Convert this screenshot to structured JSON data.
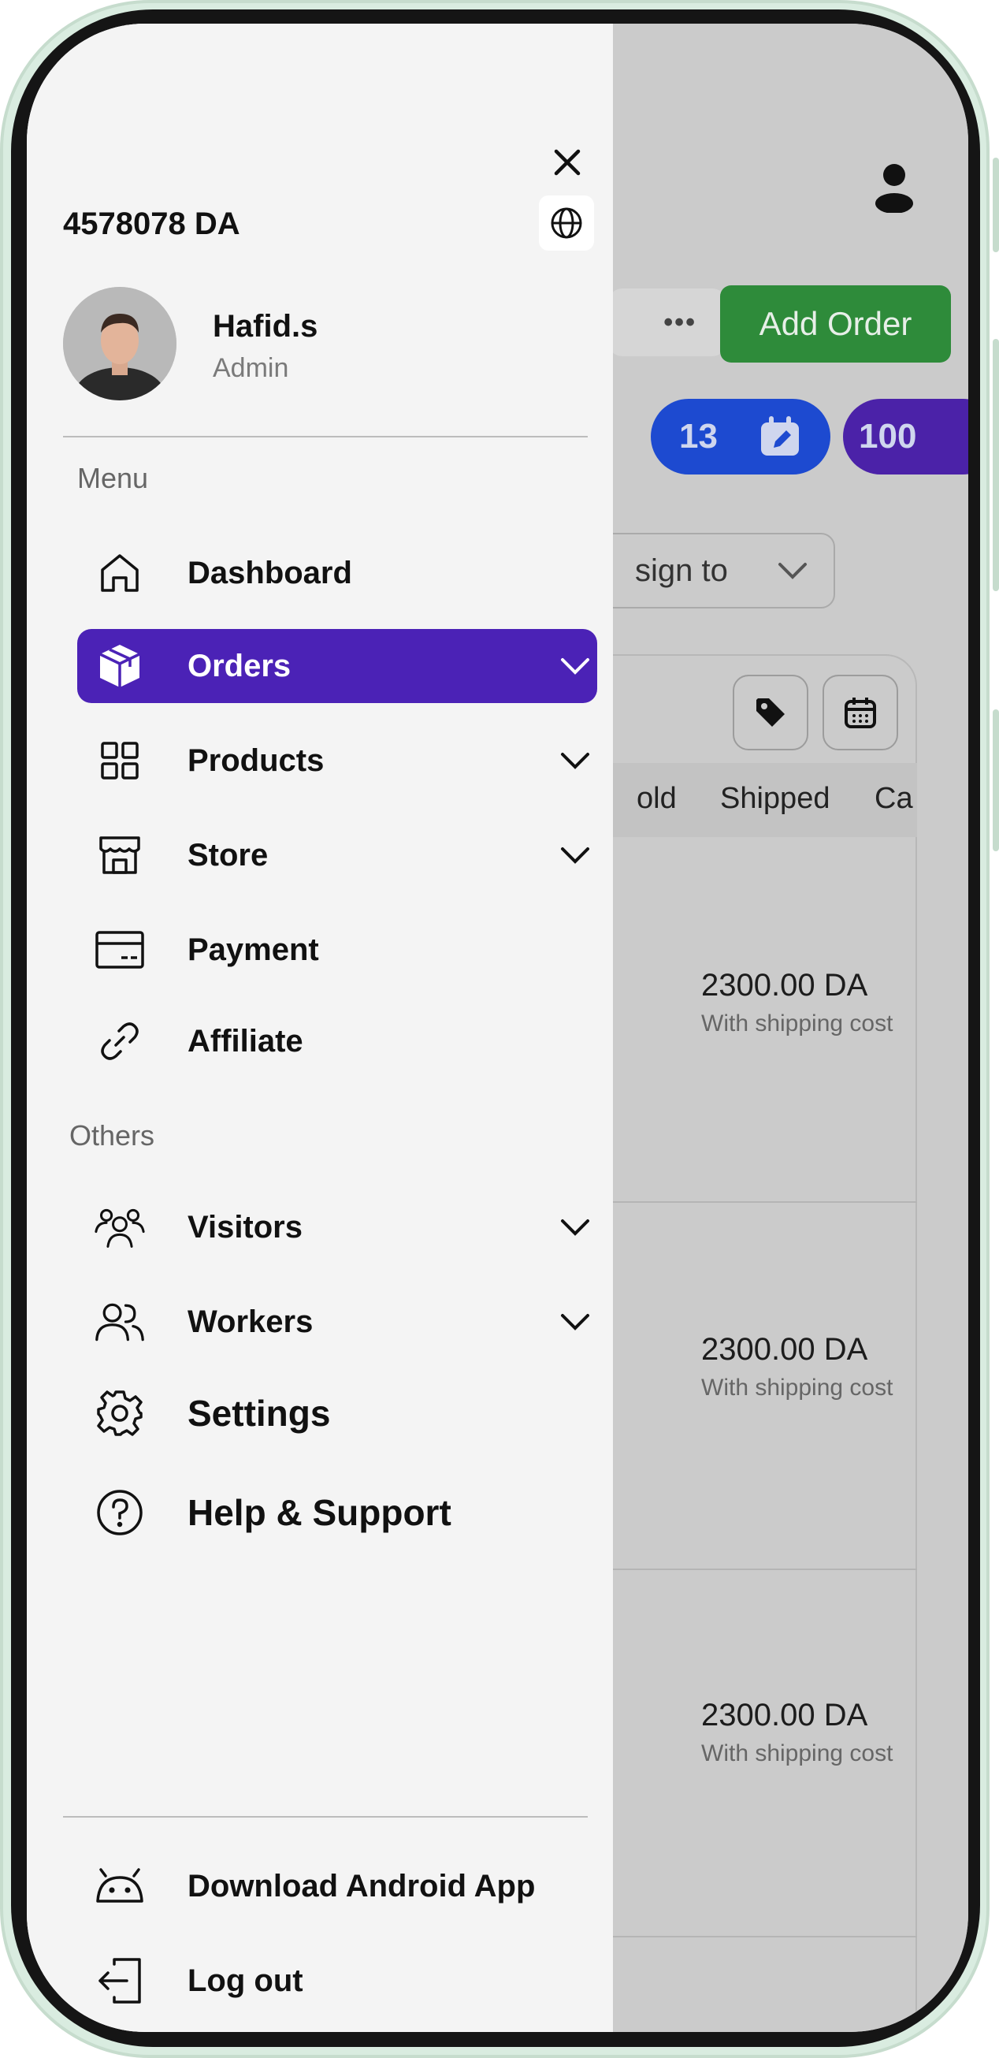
{
  "wallet": {
    "balance": "4578078 DA"
  },
  "user": {
    "name": "Hafid.s",
    "role": "Admin"
  },
  "sections": {
    "menu": "Menu",
    "others": "Others"
  },
  "menu": [
    {
      "id": "dashboard",
      "label": "Dashboard",
      "icon": "home-icon",
      "chevron": false,
      "active": false
    },
    {
      "id": "orders",
      "label": "Orders",
      "icon": "package-icon",
      "chevron": true,
      "active": true
    },
    {
      "id": "products",
      "label": "Products",
      "icon": "grid-icon",
      "chevron": true,
      "active": false
    },
    {
      "id": "store",
      "label": "Store",
      "icon": "store-icon",
      "chevron": true,
      "active": false
    },
    {
      "id": "payment",
      "label": "Payment",
      "icon": "credit-card-icon",
      "chevron": false,
      "active": false
    },
    {
      "id": "affiliate",
      "label": "Affiliate",
      "icon": "link-icon",
      "chevron": false,
      "active": false
    }
  ],
  "others": [
    {
      "id": "visitors",
      "label": "Visitors",
      "icon": "visitors-icon",
      "chevron": true
    },
    {
      "id": "workers",
      "label": "Workers",
      "icon": "users-icon",
      "chevron": true
    },
    {
      "id": "settings",
      "label": "Settings",
      "icon": "gear-icon",
      "chevron": false
    },
    {
      "id": "help",
      "label": "Help & Support",
      "icon": "help-icon",
      "chevron": false
    }
  ],
  "footer": {
    "android": "Download Android App",
    "logout": "Log out"
  },
  "background": {
    "more": "•••",
    "add_order": "Add Order",
    "pill_blue": "13",
    "pill_purple": "100",
    "assign": "sign to",
    "columns": [
      "old",
      "Shipped",
      "Ca"
    ],
    "rows": [
      {
        "price": "2300.00 DA",
        "note": "With shipping cost"
      },
      {
        "price": "2300.00 DA",
        "note": "With shipping cost"
      },
      {
        "price": "2300.00 DA",
        "note": "With shipping cost"
      }
    ]
  },
  "colors": {
    "accent": "#4b22b6",
    "add_order": "#2e8b3a",
    "pill_blue": "#1d4ad0",
    "pill_purple": "#4b22a8"
  }
}
